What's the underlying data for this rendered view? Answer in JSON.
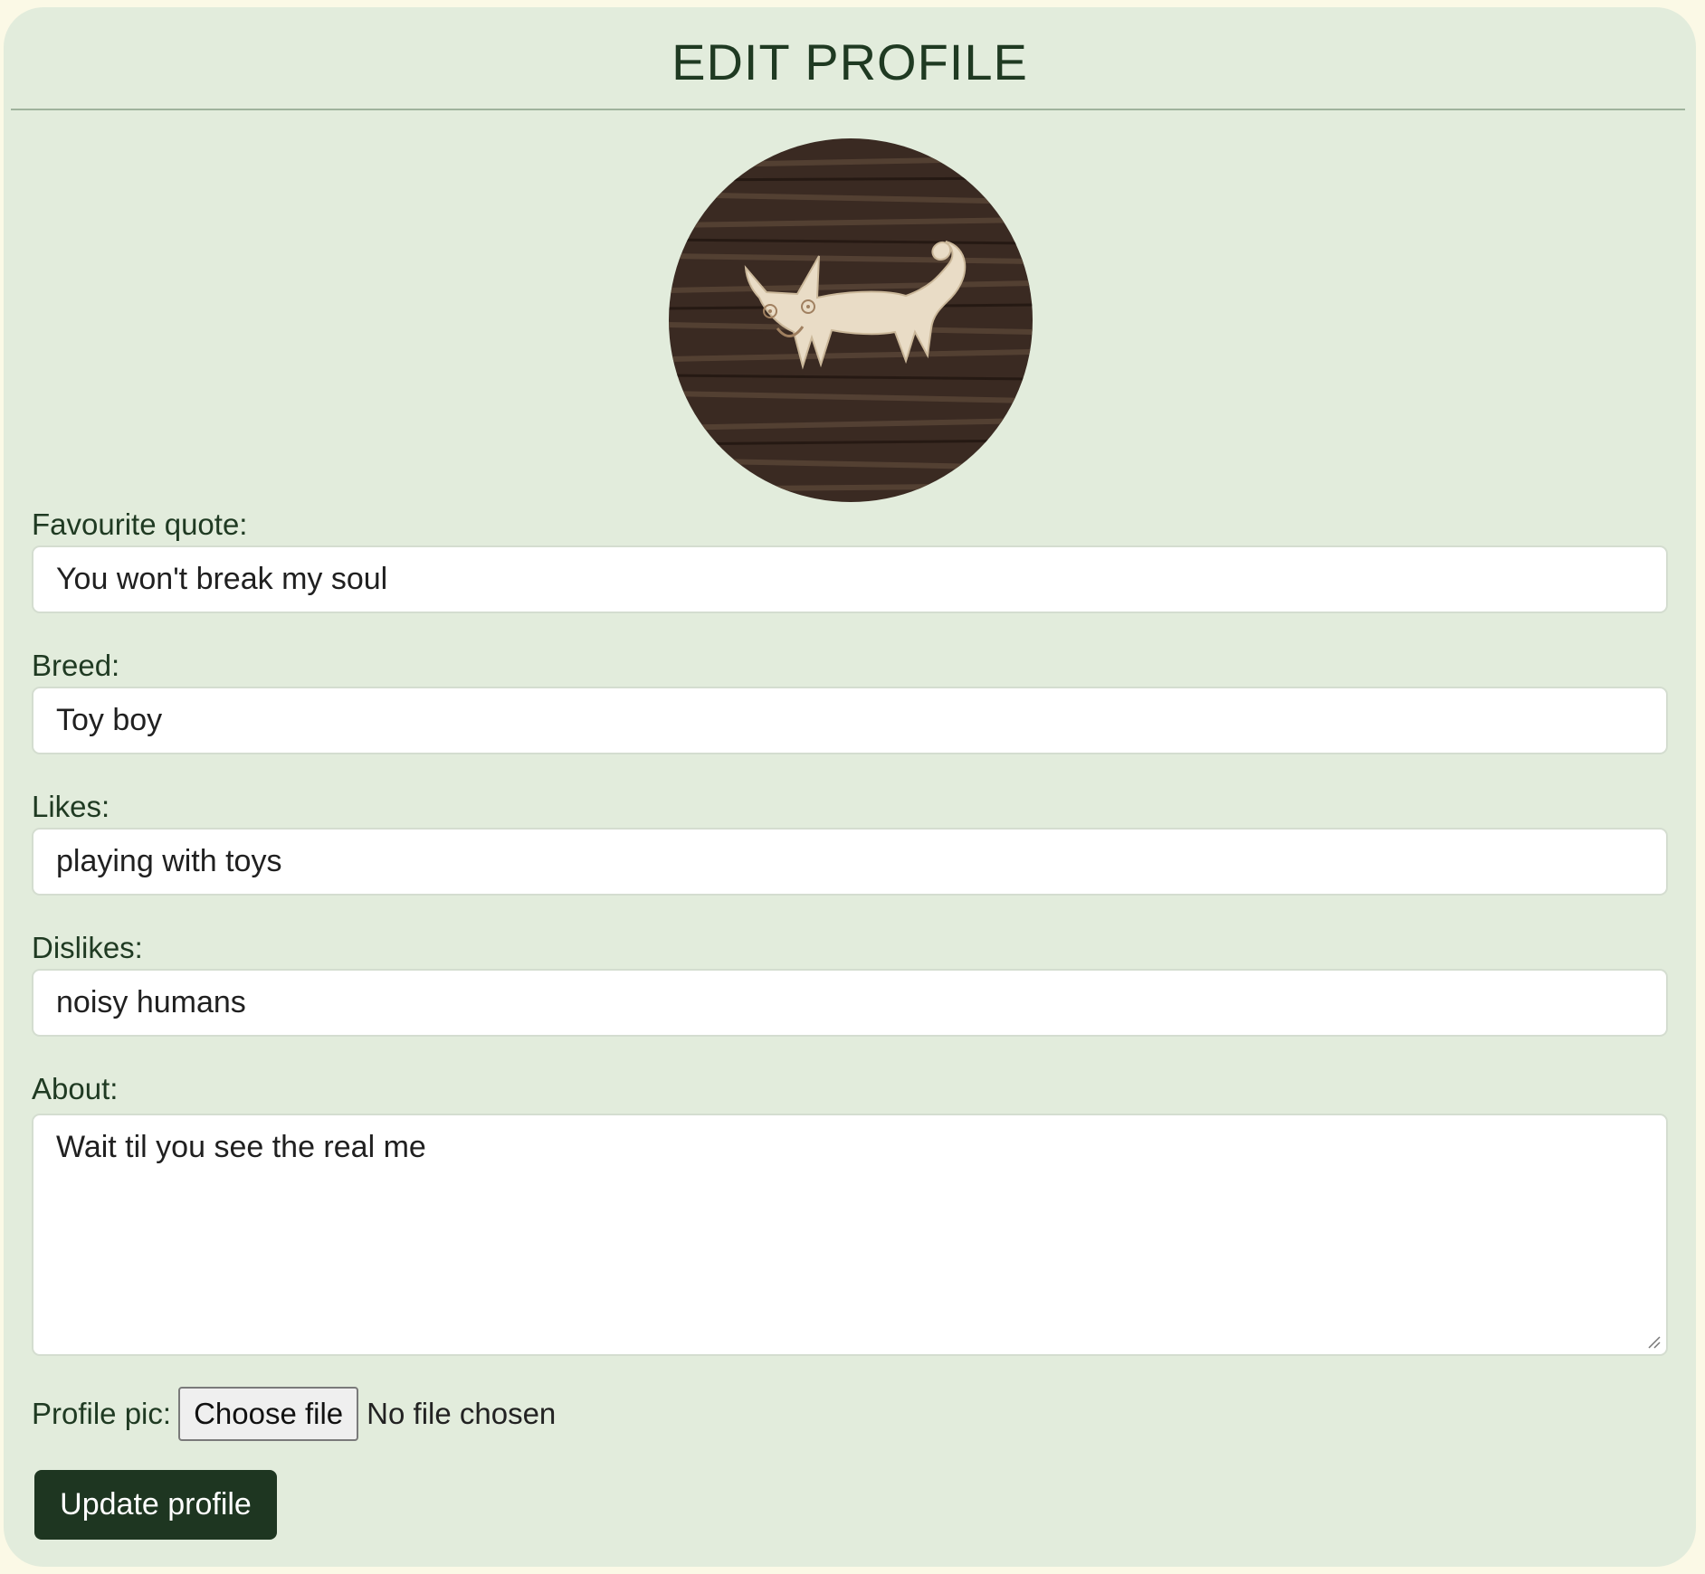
{
  "page": {
    "title": "EDIT PROFILE"
  },
  "avatar": {
    "icon": "cat-avatar"
  },
  "form": {
    "quote": {
      "label": "Favourite quote:",
      "value": "You won't break my soul"
    },
    "breed": {
      "label": "Breed:",
      "value": "Toy boy"
    },
    "likes": {
      "label": "Likes:",
      "value": "playing with toys"
    },
    "dislikes": {
      "label": "Dislikes:",
      "value": "noisy humans"
    },
    "about": {
      "label": "About:",
      "value": "Wait til you see the real me"
    },
    "profile_pic": {
      "label": "Profile pic:",
      "button": "Choose file",
      "status": "No file chosen"
    },
    "submit": "Update profile"
  },
  "colors": {
    "page_bg": "#fbf9e6",
    "card_bg": "#e2ecdc",
    "text": "#1f3a22",
    "button_bg": "#1e3621"
  }
}
